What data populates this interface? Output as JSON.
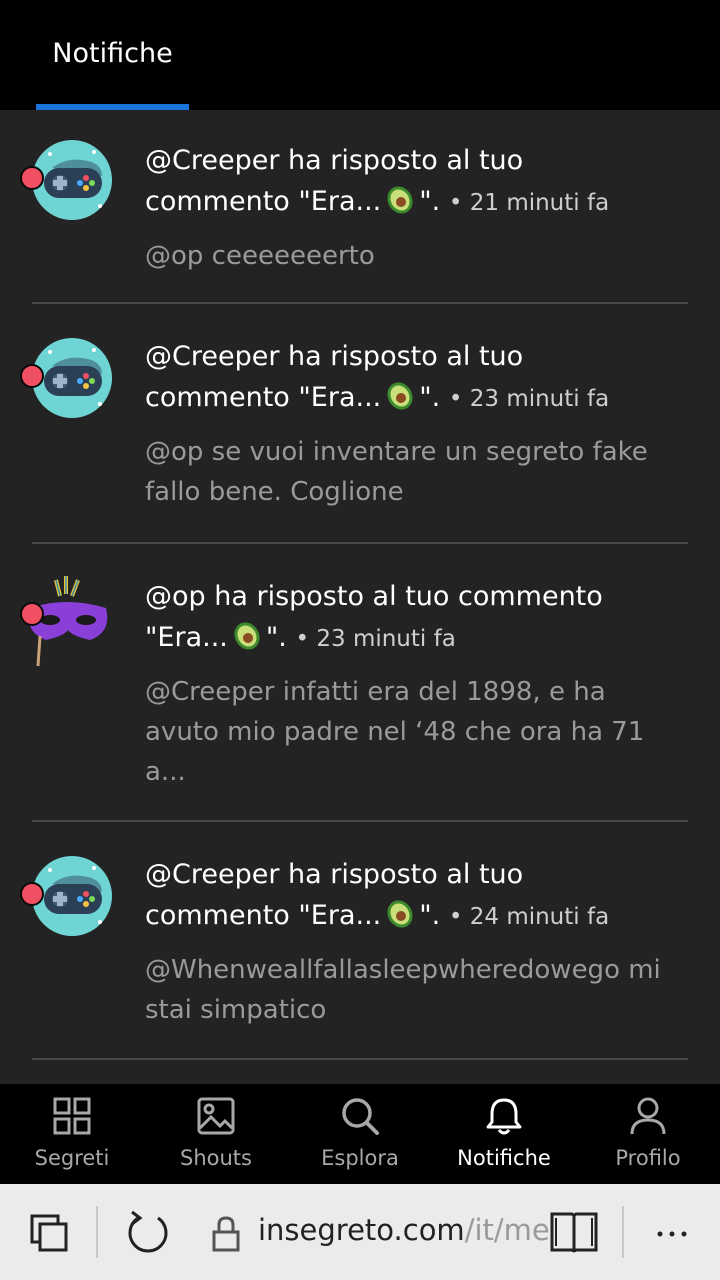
{
  "header": {
    "tab_label": "Notifiche"
  },
  "notifications": [
    {
      "title": "@Creeper ha risposto al tuo commento \"Era...",
      "suffix": "\".",
      "time": "• 21 minuti fa",
      "preview": "@op ceeeeeeerto",
      "avatar": "gamepad-avatar"
    },
    {
      "title": "@Creeper ha risposto al tuo commento \"Era...",
      "suffix": "\".",
      "time": "• 23 minuti fa",
      "preview": "@op se vuoi inventare un segreto fake fallo bene. Coglione",
      "avatar": "gamepad-avatar"
    },
    {
      "title": "@op ha risposto al tuo commento \"Era...",
      "suffix": "\".",
      "time": "• 23 minuti fa",
      "preview": "@Creeper infatti era del 1898, e ha avuto mio padre nel ‘48 che ora ha 71 a...",
      "avatar": "mask-avatar"
    },
    {
      "title": "@Creeper ha risposto al tuo commento \"Era...",
      "suffix": "\".",
      "time": "• 24 minuti fa",
      "preview": "@Whenweallfallasleepwheredowego mi stai simpatico",
      "avatar": "gamepad-avatar"
    }
  ],
  "bottom_nav": [
    {
      "label": "Segreti",
      "icon": "grid-icon",
      "active": false
    },
    {
      "label": "Shouts",
      "icon": "image-icon",
      "active": false
    },
    {
      "label": "Esplora",
      "icon": "search-icon",
      "active": false
    },
    {
      "label": "Notifiche",
      "icon": "bell-icon",
      "active": true
    },
    {
      "label": "Profilo",
      "icon": "user-icon",
      "active": false
    }
  ],
  "browser": {
    "url_domain": "insegreto.com",
    "url_path": "/it/me"
  },
  "colors": {
    "accent": "#1a73d9",
    "unread_dot": "#f05061",
    "background": "#232323",
    "nav_background": "#000000"
  }
}
